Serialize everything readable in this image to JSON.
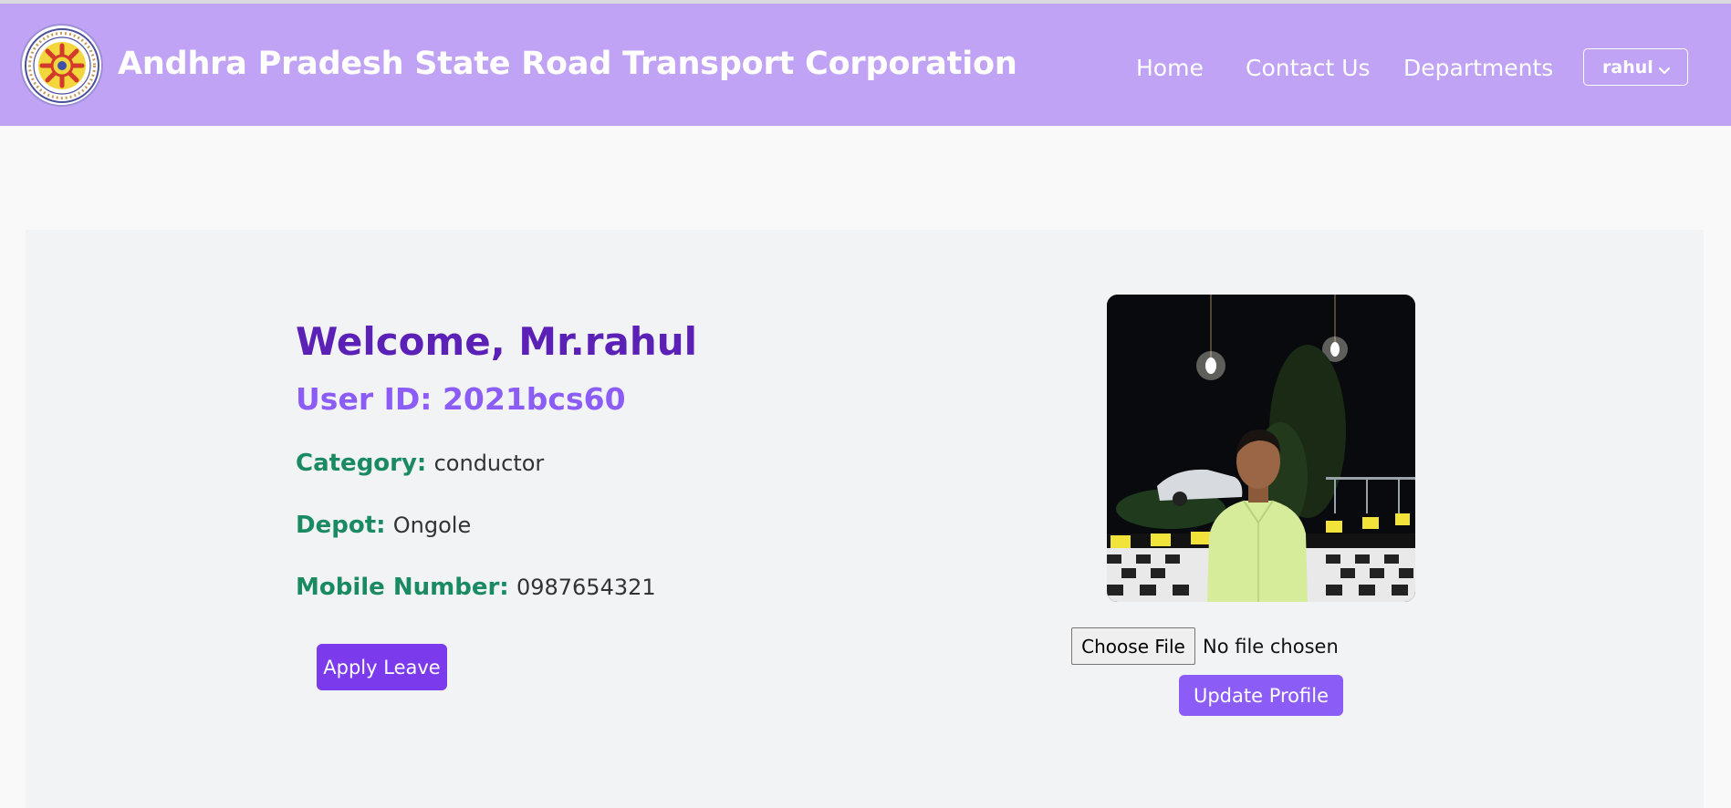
{
  "header": {
    "logo_icon": "apsrtc-emblem-icon",
    "title": "Andhra Pradesh State Road Transport Corporation",
    "nav": {
      "home": "Home",
      "contact": "Contact Us",
      "departments": "Departments"
    },
    "user_menu": {
      "label": "rahul",
      "icon": "chevron-down-icon"
    }
  },
  "profile": {
    "welcome": "Welcome, Mr.rahul",
    "user_id": "User ID: 2021bcs60",
    "category_label": "Category:",
    "category_value": "conductor",
    "depot_label": "Depot:",
    "depot_value": "Ongole",
    "mobile_label": "Mobile Number:",
    "mobile_value": "0987654321",
    "apply_leave": "Apply Leave"
  },
  "photo_section": {
    "choose_file": "Choose File",
    "file_status": "No file chosen",
    "update_profile": "Update Profile"
  },
  "colors": {
    "navbar": "#c0a3f5",
    "welcome": "#5b21b6",
    "user_id": "#8b5cf6",
    "field_label": "#1a8a62",
    "apply_button": "#7c3aed",
    "update_button": "#8b5cf6"
  }
}
